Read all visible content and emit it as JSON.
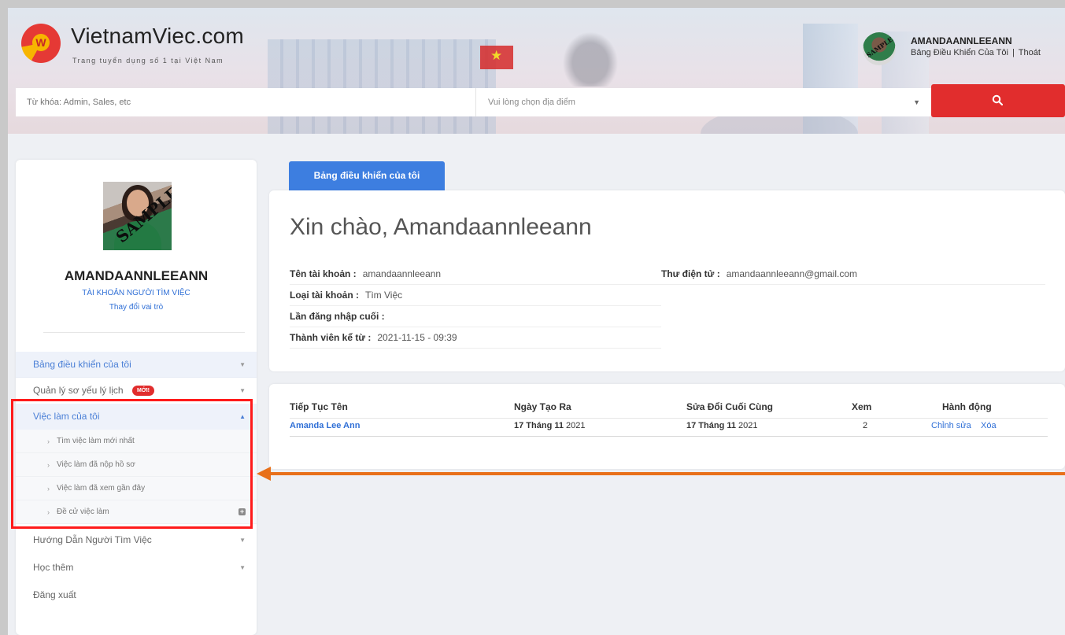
{
  "brand": {
    "name": "VietnamViec.com",
    "tagline": "Trang tuyển dụng số 1 tại Việt Nam",
    "logo_letter": "W",
    "color": "#e53935"
  },
  "user_menu": {
    "avatar_stamp": "SAMPLE",
    "username": "AMANDAANNLEEANN",
    "dashboard_link": "Bảng Điều Khiển Của Tôi",
    "separator": "|",
    "logout_link": "Thoát"
  },
  "search": {
    "keyword_placeholder": "Từ khóa: Admin, Sales, etc",
    "location_placeholder": "Vui lòng chọn địa điểm",
    "button_icon": "search-icon",
    "button_color": "#e12d2d"
  },
  "profile": {
    "photo_stamp": "SAMPLE",
    "name": "AMANDAANNLEEANN",
    "role": "TÀI KHOẢN NGƯỜI TÌM VIỆC",
    "switch_role": "Thay đổi vai trò"
  },
  "sidebar": {
    "items": [
      {
        "label": "Bảng điều khiển của tôi"
      },
      {
        "label": "Quản lý sơ yếu lý lịch",
        "badge": "MỚI!"
      },
      {
        "label": "Việc làm của tôi"
      },
      {
        "label": "Hướng Dẫn Người Tìm Việc"
      },
      {
        "label": "Học thêm"
      },
      {
        "label": "Đăng xuất"
      }
    ],
    "subitems": [
      {
        "label": "Tìm việc làm mới nhất"
      },
      {
        "label": "Việc làm đã nộp hồ sơ"
      },
      {
        "label": "Việc làm đã xem gần đây"
      },
      {
        "label": "Đề cử việc làm"
      }
    ]
  },
  "main": {
    "tab_label": "Bảng điều khiển của tôi",
    "greeting": "Xin chào, Amandaannleeann",
    "fields": {
      "account_name_label": "Tên tài khoản :",
      "account_name_value": "amandaannleeann",
      "email_label": "Thư điện tử :",
      "email_value": "amandaannleeann@gmail.com",
      "account_type_label": "Loại tài khoản :",
      "account_type_value": "Tìm Việc",
      "last_login_label": "Lần đăng nhập cuối :",
      "last_login_value": "",
      "member_since_label": "Thành viên kể từ :",
      "member_since_value": "2021-11-15 - 09:39"
    },
    "table": {
      "headers": [
        "Tiếp Tục Tên",
        "Ngày Tạo Ra",
        "Sửa Đổi Cuối Cùng",
        "Xem",
        "Hành động"
      ],
      "rows": [
        {
          "name": "Amanda Lee Ann",
          "created_day": "17 Tháng 11",
          "created_year": " 2021",
          "modified_day": "17 Tháng 11",
          "modified_year": " 2021",
          "views": "2",
          "edit": "Chỉnh sửa",
          "delete": "Xóa"
        }
      ]
    }
  },
  "annotation": {
    "highlight_color": "#ff1a1a",
    "arrow_color": "#e8701a"
  }
}
